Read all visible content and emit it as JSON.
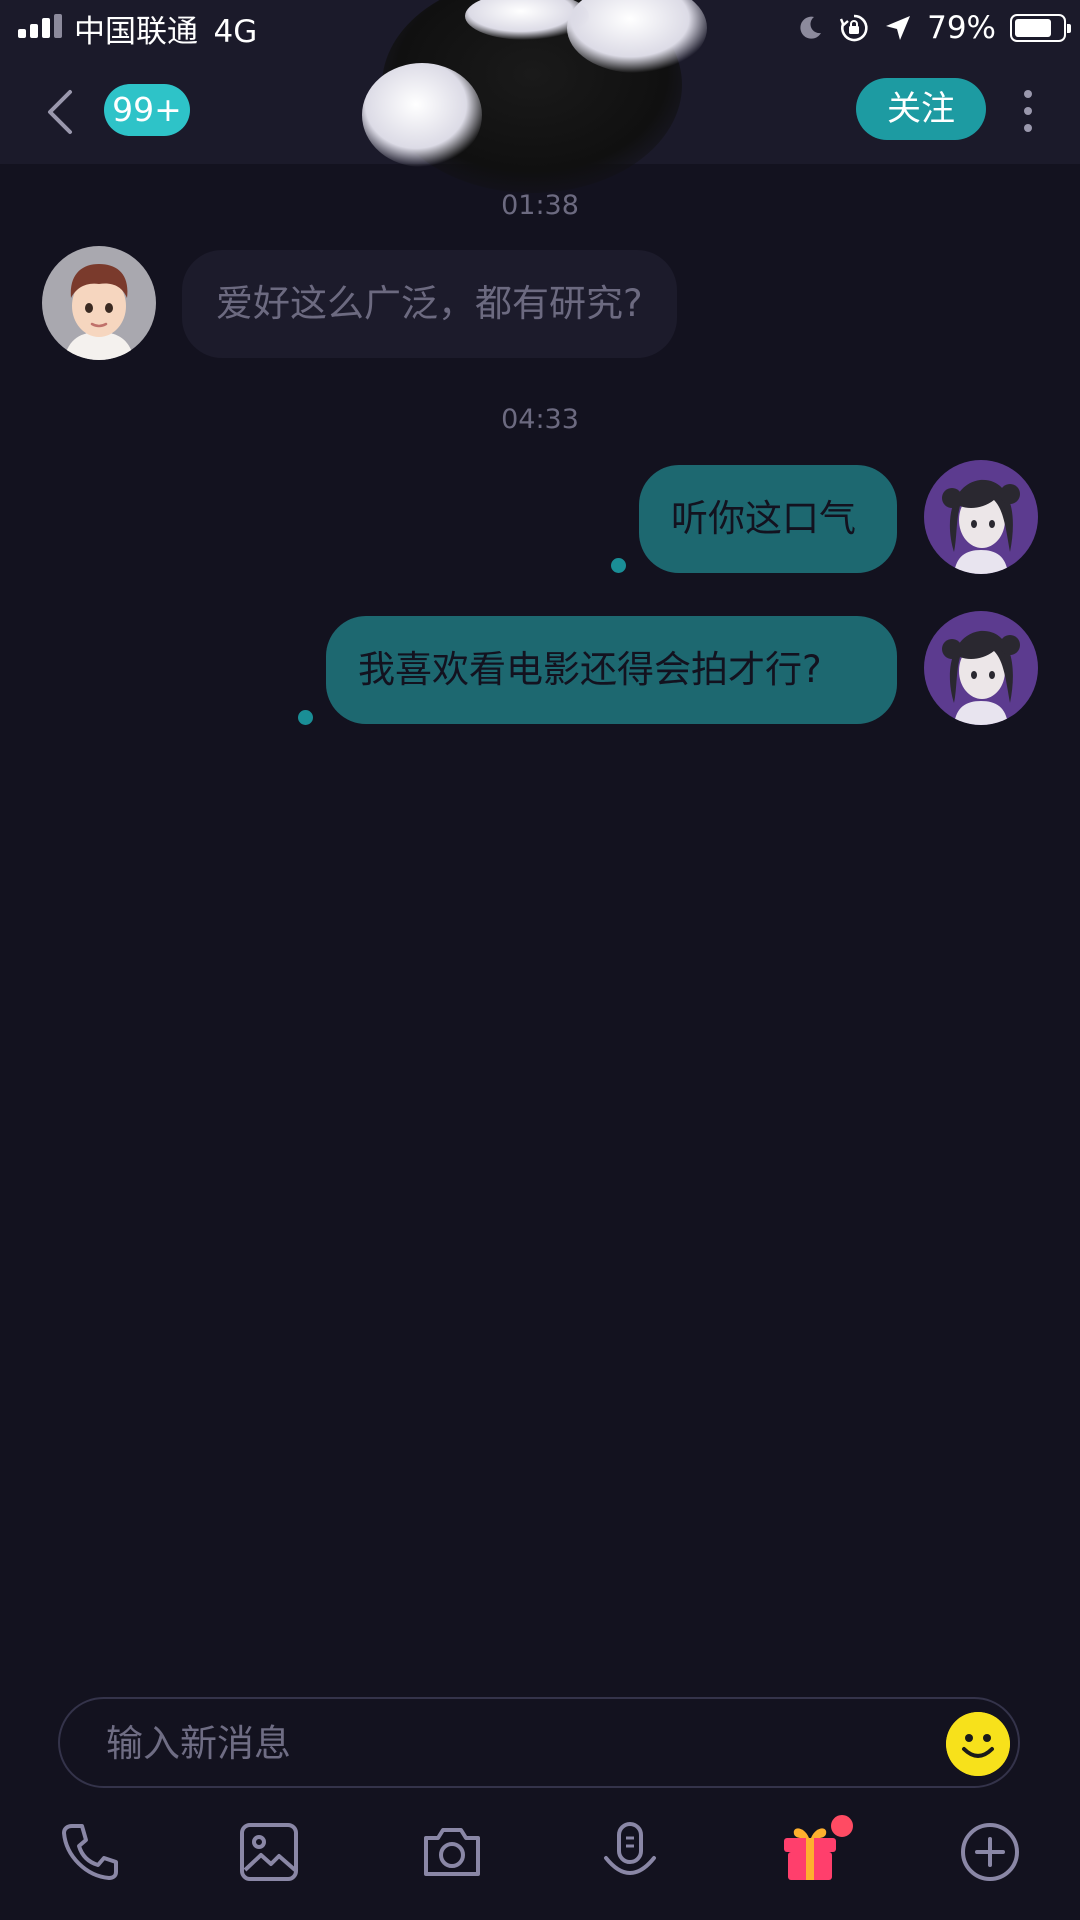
{
  "status_bar": {
    "carrier": "中国联通",
    "network": "4G",
    "battery_percent": "79%",
    "battery_level": 0.79,
    "icons": [
      "signal-icon",
      "moon-icon",
      "rotation-lock-icon",
      "location-arrow-icon",
      "battery-icon"
    ]
  },
  "nav": {
    "unread_badge": "99+",
    "follow_label": "关注",
    "icons": [
      "back-chevron-icon",
      "more-vertical-icon"
    ]
  },
  "messages": [
    {
      "timestamp": "01:38"
    },
    {
      "direction": "incoming",
      "text": "爱好这么广泛，都有研究?"
    },
    {
      "timestamp": "04:33"
    },
    {
      "direction": "outgoing",
      "text": "听你这口气"
    },
    {
      "direction": "outgoing",
      "text": "我喜欢看电影还得会拍才行?"
    }
  ],
  "composer": {
    "placeholder": "输入新消息",
    "emoji_icon": "smiley-icon"
  },
  "toolbar": {
    "items": [
      "phone-icon",
      "image-icon",
      "camera-icon",
      "voice-icon",
      "gift-icon",
      "plus-circle-icon"
    ]
  },
  "colors": {
    "background": "#13121f",
    "header": "#1b1a2a",
    "accent": "#2ec3c8",
    "outgoing_bubble": "#1d6870",
    "incoming_bubble": "#1c1b2b",
    "emoji": "#f7e11b",
    "gift": "#ff3f6c"
  }
}
